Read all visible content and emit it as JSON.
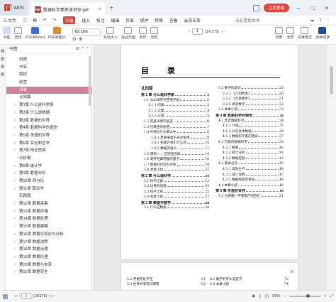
{
  "app": {
    "name": "WPS",
    "tab_title": "数据科学素养读书馆.pdf",
    "login_label": "立即登录",
    "colors": {
      "accent": "#e8453c",
      "selected_bookmark": "#c9869b"
    }
  },
  "menu": {
    "items": [
      "三 文件",
      "",
      "",
      "",
      "",
      "开始",
      "插入",
      "批注",
      "编辑",
      "页面",
      "保护",
      "转换",
      "查看",
      "会员专享"
    ],
    "active_index": 5,
    "search_label": "点此查找命令",
    "right_items": [
      "",
      "",
      ""
    ]
  },
  "toolbar": {
    "tools": [
      "手型",
      "选择",
      "PDF转Word",
      "PDF转图片"
    ],
    "zoom": "89.15%",
    "view_tools": [
      "实际大小",
      "适合页面",
      "单页",
      "双页",
      "连续阅读"
    ],
    "page_input": "1",
    "page_total": "(14/375)",
    "right_tools": [
      "背景",
      "全屏",
      "阅读模式",
      "查找",
      "截图和对比",
      "连续阅读"
    ]
  },
  "sidebar": {
    "title": "书签",
    "bookmarks": [
      {
        "label": "封面",
        "expandable": false,
        "selected": false
      },
      {
        "label": "书名",
        "expandable": false,
        "selected": false
      },
      {
        "label": "版权",
        "expandable": false,
        "selected": false
      },
      {
        "label": "前言",
        "expandable": false,
        "selected": false
      },
      {
        "label": "目录",
        "expandable": false,
        "selected": true
      },
      {
        "label": "认知篇",
        "expandable": false,
        "selected": false
      },
      {
        "label": "第1章 什么是科学家",
        "expandable": true,
        "selected": false
      },
      {
        "label": "第2章 什么是数据",
        "expandable": true,
        "selected": false
      },
      {
        "label": "第3章 数据的世界",
        "expandable": true,
        "selected": false
      },
      {
        "label": "第4章 数据科学的使命",
        "expandable": true,
        "selected": false
      },
      {
        "label": "第5章 矛盾的世界",
        "expandable": true,
        "selected": false
      },
      {
        "label": "第6章 实验和哲学",
        "expandable": true,
        "selected": false
      },
      {
        "label": "第7章 辩证思维",
        "expandable": true,
        "selected": false
      },
      {
        "label": "分析篇",
        "expandable": false,
        "selected": false
      },
      {
        "label": "第8章 统计学",
        "expandable": true,
        "selected": false
      },
      {
        "label": "第9章 数据分析",
        "expandable": true,
        "selected": false
      },
      {
        "label": "第10章 同与比",
        "expandable": true,
        "selected": false
      },
      {
        "label": "第11章 算法学",
        "expandable": true,
        "selected": false
      },
      {
        "label": "实践篇",
        "expandable": false,
        "selected": false
      },
      {
        "label": "第12章 数据采集",
        "expandable": true,
        "selected": false
      },
      {
        "label": "第13章 数据存储",
        "expandable": true,
        "selected": false
      },
      {
        "label": "第14章 数据处理",
        "expandable": true,
        "selected": false
      },
      {
        "label": "第15章 数据建模",
        "expandable": true,
        "selected": false
      },
      {
        "label": "第16章 数据可视化与分析",
        "expandable": true,
        "selected": false
      },
      {
        "label": "第17章 数据决策",
        "expandable": true,
        "selected": false
      },
      {
        "label": "第18章 数据治理",
        "expandable": true,
        "selected": false
      },
      {
        "label": "第19章 数据伦理",
        "expandable": true,
        "selected": false
      },
      {
        "label": "第20章 数据与未来",
        "expandable": true,
        "selected": false
      },
      {
        "label": "第21章 数据安全",
        "expandable": true,
        "selected": false
      }
    ]
  },
  "document": {
    "toc_title": "目 录",
    "left_column": [
      {
        "text": "认知篇",
        "page": "",
        "level": "part"
      },
      {
        "text": "第 1 章  什么是科学家",
        "page": "2",
        "level": "chapter"
      },
      {
        "text": "1.1  从太阳东升西落开始",
        "page": "2",
        "level": "l1"
      },
      {
        "text": "1.1.1  问题",
        "page": "3",
        "level": "l2"
      },
      {
        "text": "1.1.2  公理",
        "page": "4",
        "level": "l2"
      },
      {
        "text": "1.1.3  公式",
        "page": "5",
        "level": "l2"
      },
      {
        "text": "1.2  阿基米德究竟是...",
        "page": "6",
        "level": "l1"
      },
      {
        "text": "1.3  托勒密的秘密",
        "page": "7",
        "level": "l1"
      },
      {
        "text": "1.4  牛顿为什么那么牛",
        "page": "8",
        "level": "l1"
      },
      {
        "text": "1.4.1  苹果来自于天文定律",
        "page": "9",
        "level": "l3"
      },
      {
        "text": "1.4.2  构建万有引力公式",
        "page": "10",
        "level": "l3"
      },
      {
        "text": "1.4.3  数据的强大...",
        "page": "11",
        "level": "l3"
      },
      {
        "text": "1.5  遇到一...  区别在因果",
        "page": "14",
        "level": "l1"
      },
      {
        "text": "1.6  离开经典物理的量子",
        "page": "16",
        "level": "l1"
      },
      {
        "text": "1.7  数据时代的科学家",
        "page": "19",
        "level": "l1"
      },
      {
        "text": "1.8  本章小结",
        "page": "22",
        "level": "l1"
      },
      {
        "text": "第 2 章  什么是科学",
        "page": "23",
        "level": "chapter"
      },
      {
        "text": "2.1  科学之路",
        "page": "23",
        "level": "l1"
      },
      {
        "text": "2.2  边界的迷惑",
        "page": "24",
        "level": "l1"
      },
      {
        "text": "2.3  科学之思",
        "page": "25",
        "level": "l1"
      },
      {
        "text": "2.4  本章小结",
        "page": "27",
        "level": "l1"
      },
      {
        "text": "第 3 章  数据与数学",
        "page": "28",
        "level": "chapter"
      },
      {
        "text": "3.1  什么是数据",
        "page": "28",
        "level": "l1"
      }
    ],
    "right_column": [
      {
        "text": "3.2  数学的奥妙",
        "page": "29",
        "level": "l1"
      },
      {
        "text": "3.2.1  《几何原本》",
        "page": "30",
        "level": "l2"
      },
      {
        "text": "3.2.2  《九章算术》",
        "page": "31",
        "level": "l2"
      },
      {
        "text": "3.2.3  高等数学",
        "page": "32",
        "level": "l2"
      },
      {
        "text": "3.3  本章小结",
        "page": "33",
        "level": "l1"
      },
      {
        "text": "第 4 章  数据科学的使命",
        "page": "34",
        "level": "chapter"
      },
      {
        "text": "4.1  走近数据科学",
        "page": "34",
        "level": "l1"
      },
      {
        "text": "4.1.1  介绍",
        "page": "35",
        "level": "l2"
      },
      {
        "text": "4.1.2  认识总体数据",
        "page": "36",
        "level": "l2"
      },
      {
        "text": "4.1.3  数据科学家的使命",
        "page": "37",
        "level": "l2"
      },
      {
        "text": "4.2  万能的数据科学",
        "page": "38",
        "level": "l1"
      },
      {
        "text": "4.2.1  概要",
        "page": "40",
        "level": "l2"
      },
      {
        "text": "4.2.2  统计分析",
        "page": "41",
        "level": "l2"
      },
      {
        "text": "4.2.3  数据挖掘",
        "page": "43",
        "level": "l2"
      },
      {
        "text": "4.3  使命必达",
        "page": "45",
        "level": "l1"
      },
      {
        "text": "4.3.1  高效生产",
        "page": "46",
        "level": "l2"
      },
      {
        "text": "4.3.2  减少浪费",
        "page": "47",
        "level": "l2"
      },
      {
        "text": "4.3.3  数据探索的使命",
        "page": "48",
        "level": "l2"
      },
      {
        "text": "4.4  本章小结",
        "page": "49",
        "level": "l1"
      },
      {
        "text": "第 5 章  矛盾的世界",
        "page": "50",
        "level": "chapter"
      },
      {
        "text": "5.1  古希腊一学者再产的回忆",
        "page": "51",
        "level": "l1"
      }
    ],
    "page_footer": "IX",
    "page2_rows": [
      {
        "left": "5.2  矛盾无处不在",
        "left_page": "61",
        "right": "6.3  数学的尽头是哲学",
        "right_page": "72"
      },
      {
        "left": "5.3  世界并非非对即错",
        "left_page": "62",
        "right": "6.4  本章小结",
        "right_page": "74"
      }
    ]
  },
  "status": {
    "page_input": "1",
    "page_total": "(14/375)",
    "zoom": "89%"
  }
}
